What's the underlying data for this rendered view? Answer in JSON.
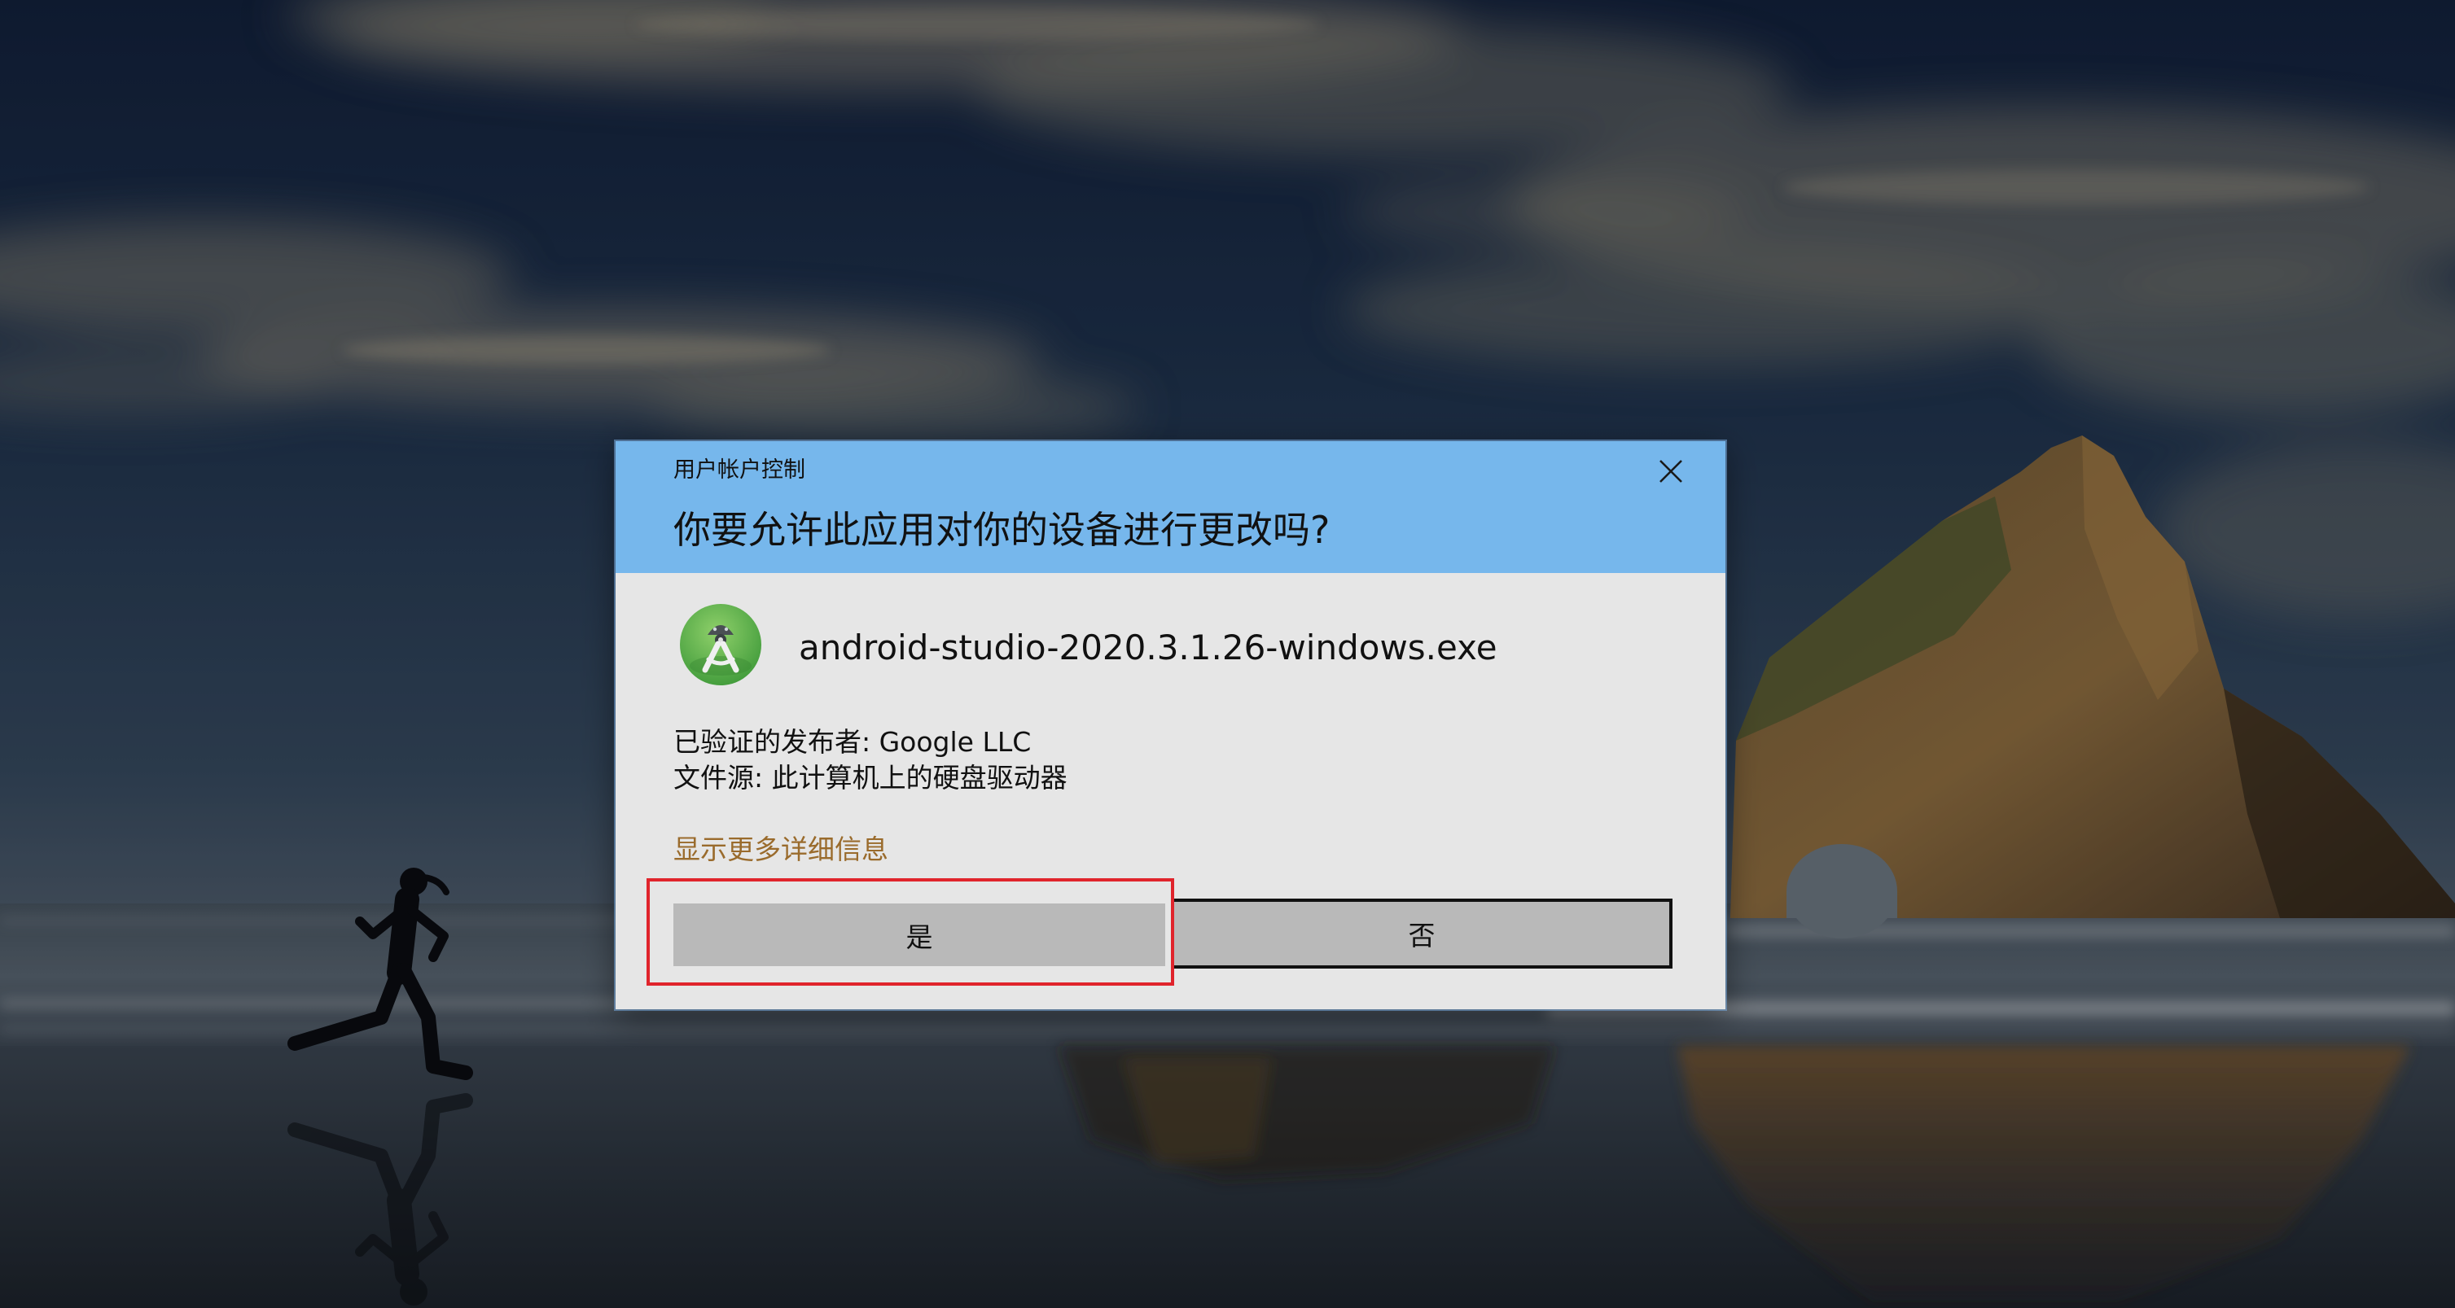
{
  "dialog": {
    "window_title": "用户帐户控制",
    "question": "你要允许此应用对你的设备进行更改吗?",
    "close_icon": "close-icon",
    "app": {
      "icon": "android-studio-icon",
      "name": "android-studio-2020.3.1.26-windows.exe"
    },
    "publisher": "已验证的发布者: Google LLC",
    "file_source": "文件源: 此计算机上的硬盘驱动器",
    "details_link": "显示更多详细信息",
    "buttons": {
      "yes": "是",
      "no": "否"
    },
    "focused_button": "no"
  },
  "annotation": {
    "highlighted_element": "yes-button"
  },
  "colors": {
    "header_bg": "#76b7ec",
    "body_bg": "#e6e6e6",
    "button_bg": "#b9b9b9",
    "link": "#9a6b2c",
    "highlight": "#e0242c",
    "focus_border": "#111111"
  }
}
